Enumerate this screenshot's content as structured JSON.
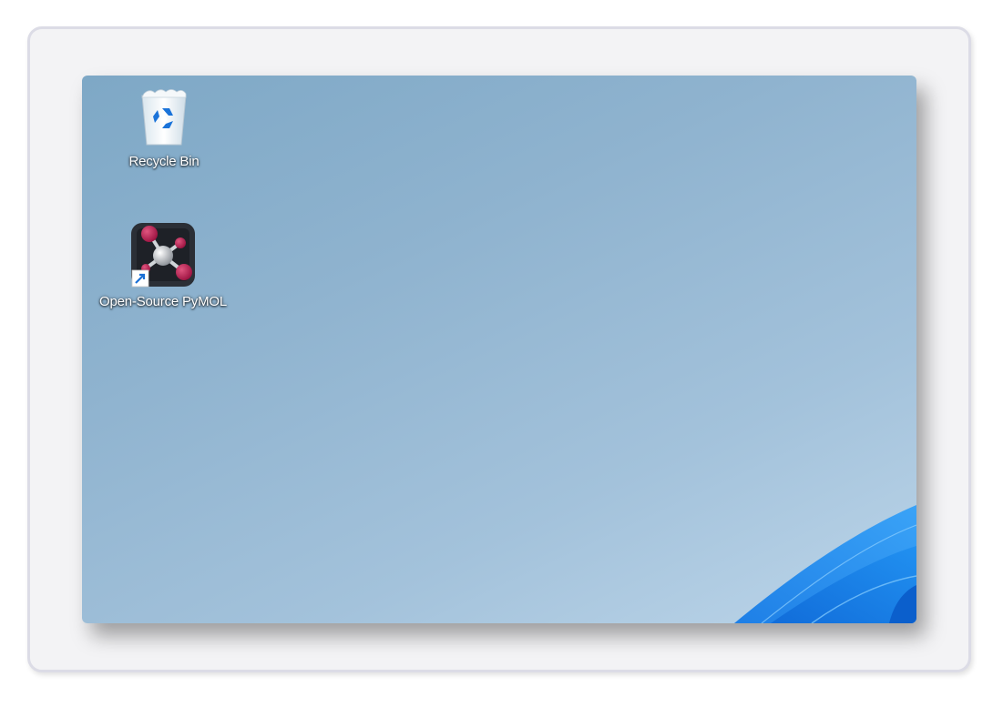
{
  "desktop": {
    "icons": [
      {
        "label": "Recycle Bin",
        "icon": "recycle-bin-icon"
      },
      {
        "label": "Open-Source PyMOL",
        "icon": "pymol-shortcut-icon",
        "shortcut_overlay": "shortcut-arrow-icon"
      }
    ],
    "wallpaper": "windows-11-bloom",
    "colors": {
      "background_start": "#7ea8c6",
      "background_end": "#bcd5e9",
      "bloom_blue": "#1f8ff0",
      "pymol_atom": "#b0184a"
    }
  }
}
